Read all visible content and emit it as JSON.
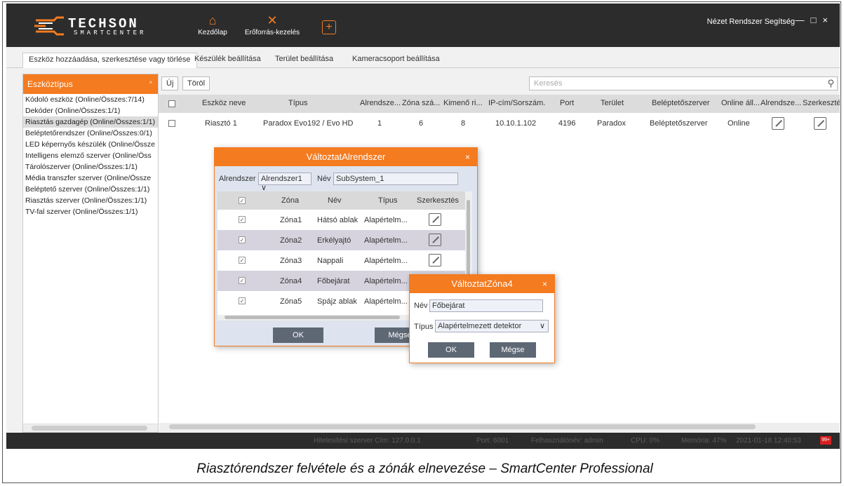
{
  "app": {
    "brand": "TECHSON",
    "brand_sub": "SMARTCENTER",
    "nav": [
      {
        "label": "Kezdőlap",
        "icon": "home-icon"
      },
      {
        "label": "Erőforrás-kezelés",
        "icon": "tools-icon"
      }
    ],
    "add_icon": "plus-icon",
    "top_menu": "Nézet Rendszer Segítség",
    "window_controls": [
      "—",
      "□",
      "×"
    ]
  },
  "tabs": [
    "Eszköz hozzáadása, szerkesztése vagy törlése",
    "Készülék beállítása",
    "Terület beállítása",
    "Kameracsoport beállítása"
  ],
  "sidebar": {
    "title": "Eszköztípus",
    "items": [
      "Kódoló eszköz (Online/Összes:7/14)",
      "Dekóder (Online/Összes:1/1)",
      "Riasztás gazdagép (Online/Összes:1/1)",
      "Beléptetőrendszer (Online/Összes:0/1)",
      "LED képernyős készülék (Online/Össze",
      "Intelligens elemző szerver (Online/Öss",
      "Tárolószerver (Online/Összes:1/1)",
      "Média transzfer szerver (Online/Össze",
      "Beléptető szerver (Online/Összes:1/1)",
      "Riasztás szerver (Online/Összes:1/1)",
      "TV-fal szerver (Online/Összes:1/1)"
    ],
    "selected_index": 2
  },
  "toolbar": {
    "new_label": "Új",
    "delete_label": "Töröl",
    "search_placeholder": "Keresés"
  },
  "table": {
    "headers": [
      "Eszköz neve",
      "Típus",
      "Alrendsze...",
      "Zóna szá...",
      "Kimenő ri...",
      "IP-cím/Sorszám.",
      "Port",
      "Terület",
      "Beléptetőszerver",
      "Online áll...",
      "Alrendsze...",
      "Szerkesztés"
    ],
    "rows": [
      {
        "name": "Riasztó 1",
        "type": "Paradox Evo192 / Evo HD",
        "subsystems": "1",
        "zones": "6",
        "outputs": "8",
        "ip": "10.10.1.102",
        "port": "4196",
        "area": "Paradox",
        "access_server": "Beléptetőszerver",
        "online": "Online"
      }
    ]
  },
  "dialog_subsystem": {
    "title": "VáltoztatAlrendszer",
    "subsystem_label": "Alrendszer",
    "subsystem_value": "Alrendszer1",
    "name_label": "Név",
    "name_value": "SubSystem_1",
    "headers": [
      "Zóna",
      "Név",
      "Típus",
      "Szerkesztés"
    ],
    "zones": [
      {
        "zone": "Zóna1",
        "name": "Hátsó ablak",
        "type": "Alapértelm..."
      },
      {
        "zone": "Zóna2",
        "name": "Erkélyajtó",
        "type": "Alapértelm..."
      },
      {
        "zone": "Zóna3",
        "name": "Nappali",
        "type": "Alapértelm..."
      },
      {
        "zone": "Zóna4",
        "name": "Főbejárat",
        "type": "Alapértelm..."
      },
      {
        "zone": "Zóna5",
        "name": "Spájz ablak",
        "type": "Alapértelm..."
      }
    ],
    "ok_label": "OK",
    "cancel_label": "Mégse"
  },
  "dialog_zone": {
    "title": "VáltoztatZóna4",
    "name_label": "Név",
    "name_value": "Főbejárat",
    "type_label": "Típus",
    "type_value": "Alapértelmezett detektor",
    "ok_label": "OK",
    "cancel_label": "Mégse"
  },
  "statusbar": {
    "auth_server": "Hitelesítési szerver Cím: 127.0.0.1",
    "port": "Port: 6001",
    "user": "Felhasználónév: admin",
    "cpu": "CPU: 0%",
    "memory": "Memória: 47%",
    "datetime": "2021-01-18 12:40:53",
    "badge": "99+"
  },
  "caption": "Riasztórendszer felvétele és a zónák elnevezése – SmartCenter Professional"
}
